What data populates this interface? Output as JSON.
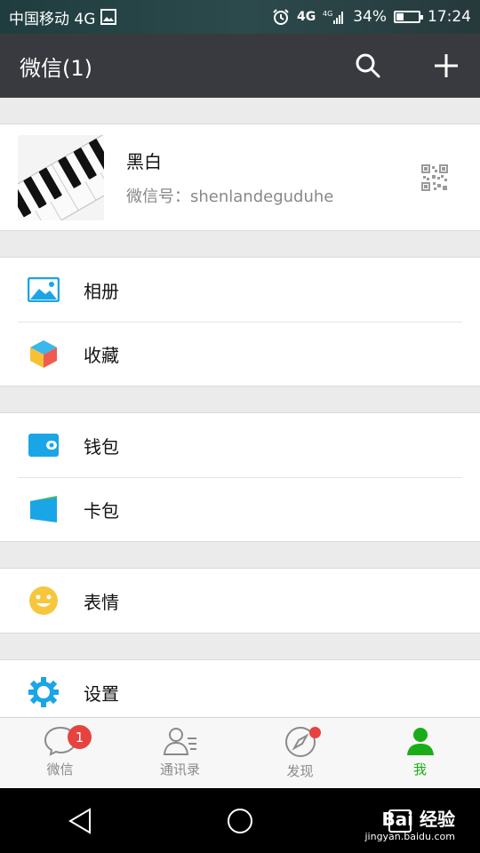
{
  "status_bar": {
    "carrier": "中国移动 4G",
    "network_left": "4G",
    "network_right": "4G",
    "battery_percent": "34%",
    "battery_level": 0.34,
    "time": "17:24"
  },
  "title_bar": {
    "title": "微信(1)",
    "search_icon": "search-icon",
    "add_icon": "plus-icon"
  },
  "profile": {
    "name": "黑白",
    "wechat_id": "微信号：shenlandeguduhe"
  },
  "menu": {
    "album": "相册",
    "favorites": "收藏",
    "wallet": "钱包",
    "cards": "卡包",
    "stickers": "表情",
    "settings": "设置"
  },
  "tabbar": {
    "tabs": [
      {
        "label": "微信",
        "badge": "1"
      },
      {
        "label": "通讯录"
      },
      {
        "label": "发现"
      },
      {
        "label": "我"
      }
    ]
  },
  "watermark": {
    "main": "Bai 经验",
    "sub": "jingyan.baidu.com"
  },
  "colors": {
    "titlebar": "#393a3f",
    "accent_green": "#1aad19",
    "badge_red": "#e64340",
    "icon_blue": "#1aa5e6"
  }
}
